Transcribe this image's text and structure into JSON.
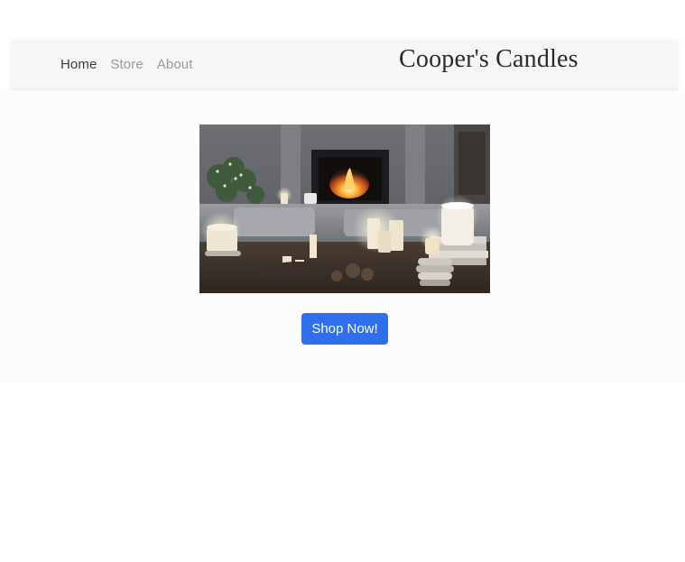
{
  "navbar": {
    "links": [
      {
        "label": "Home",
        "active": true
      },
      {
        "label": "Store",
        "active": false
      },
      {
        "label": "About",
        "active": false
      }
    ],
    "brand": "Cooper's Candles"
  },
  "hero": {
    "image_icon": "candles-fireplace-photo",
    "button_label": "Shop Now!"
  },
  "colors": {
    "navbar_bg": "#f5f6f8",
    "button_bg": "#2f6fed",
    "active_link": "#3b3b3b",
    "inactive_link": "#9a9a9a"
  }
}
